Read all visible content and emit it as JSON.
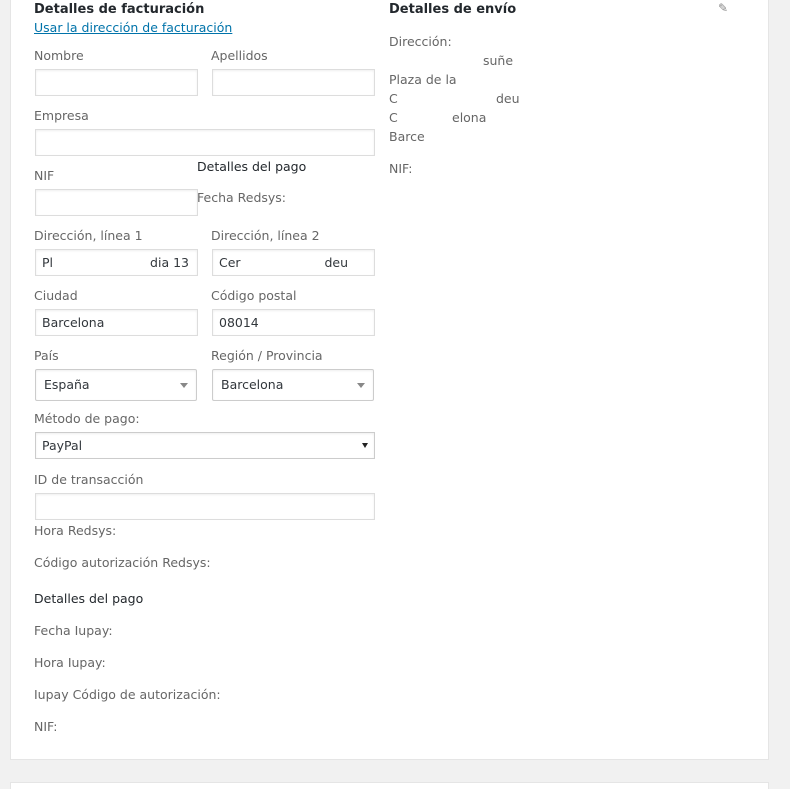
{
  "billing": {
    "heading": "Detalles de facturación",
    "use_billing_link": "Usar la dirección de facturación",
    "first_name": {
      "label": "Nombre",
      "value": ""
    },
    "last_name": {
      "label": "Apellidos",
      "value": ""
    },
    "company": {
      "label": "Empresa",
      "value": ""
    },
    "nif": {
      "label": "NIF",
      "value": ""
    },
    "address_1": {
      "label": "Dirección, línea 1",
      "value_start": "Pl",
      "value_end": "dia 13"
    },
    "address_2": {
      "label": "Dirección, línea 2",
      "value_start": "Cer",
      "value_end": "deu"
    },
    "city": {
      "label": "Ciudad",
      "value": "Barcelona"
    },
    "postcode": {
      "label": "Código postal",
      "value": "08014"
    },
    "country": {
      "label": "País",
      "value": "España"
    },
    "state": {
      "label": "Región / Provincia",
      "value": "Barcelona"
    },
    "payment_method": {
      "label": "Método de pago:",
      "value": "PayPal"
    },
    "transaction_id": {
      "label": "ID de transacción",
      "value": ""
    },
    "redsys_time": "Hora Redsys:",
    "redsys_auth": "Código autorización Redsys:",
    "iupay_heading": "Detalles del pago",
    "iupay_date": "Fecha Iupay:",
    "iupay_time": "Hora Iupay:",
    "iupay_auth": "Iupay Código de autorización:",
    "nif_bottom": "NIF:"
  },
  "overlay_payment": {
    "heading": "Detalles del pago",
    "redsys_date": "Fecha Redsys:"
  },
  "shipping": {
    "heading": "Detalles de envío",
    "edit_icon": "pencil-icon",
    "address_label": "Dirección:",
    "address_lines": [
      "",
      "Plaza de la",
      "C",
      "C",
      "Barce"
    ],
    "address_line_tails": [
      "suñe",
      "",
      "deu",
      "elona",
      ""
    ],
    "nif_label": "NIF:"
  }
}
